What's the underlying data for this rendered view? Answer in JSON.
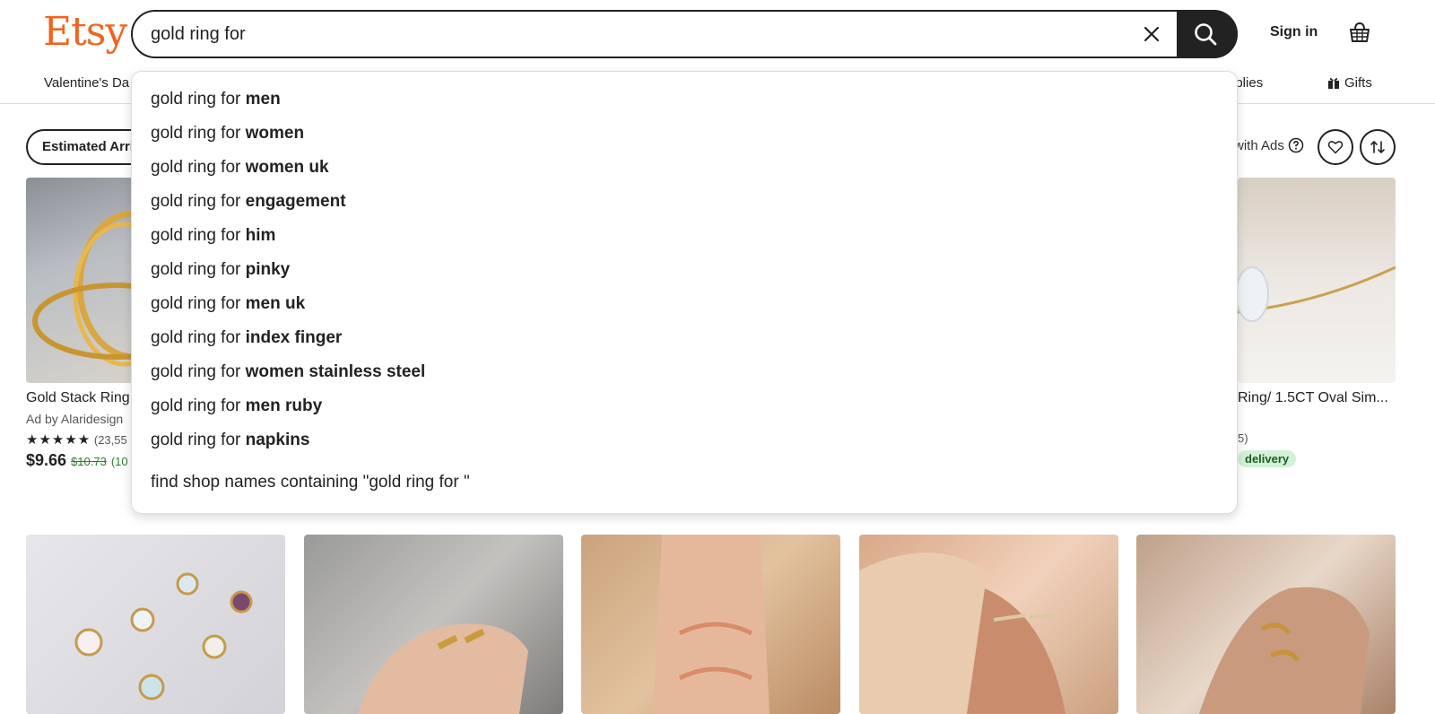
{
  "header": {
    "logo": "Etsy",
    "search_value": "gold ring for",
    "sign_in": "Sign in"
  },
  "nav": {
    "left_item": "Valentine's Da",
    "supplies": "pplies",
    "gifts": "Gifts"
  },
  "filters": {
    "arrival_pill": "Estimated Arri",
    "ads_note": "with Ads"
  },
  "suggestions": {
    "prefix": "gold ring for",
    "items": [
      "men",
      "women",
      "women uk",
      "engagement",
      "him",
      "pinky",
      "men uk",
      "index finger",
      "women stainless steel",
      "men ruby",
      "napkins"
    ],
    "find_shop": "find shop names containing \"gold ring for \""
  },
  "listings": {
    "card1": {
      "title": "Gold Stack Ring",
      "shop": "Ad by Alaridesign",
      "stars": "★★★★★",
      "reviews": "(23,55",
      "price": "$9.66",
      "old_price": "$10.73",
      "discount": "(10"
    },
    "card5": {
      "title": "Ring/ 1.5CT Oval Sim...",
      "reviews": "5)",
      "badge": "delivery"
    }
  },
  "colors": {
    "brand": "#F1641E",
    "dark": "#222222",
    "sale_green": "#2f7d32"
  }
}
